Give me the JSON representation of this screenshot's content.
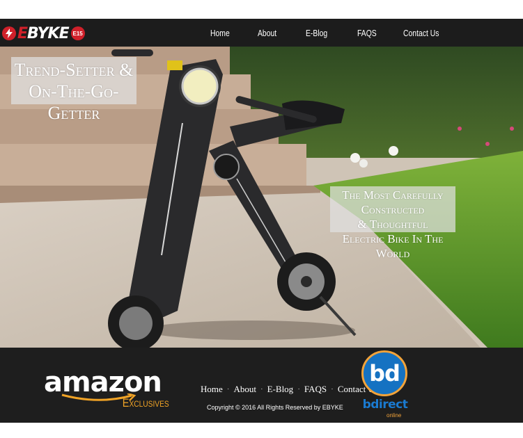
{
  "brand": {
    "logo_text_e": "E",
    "logo_text_rest": "BYKE",
    "logo_badge": "E15"
  },
  "nav": {
    "items": [
      {
        "label": "Home"
      },
      {
        "label": "About"
      },
      {
        "label": "E-Blog"
      },
      {
        "label": "FAQS"
      },
      {
        "label": "Contact Us"
      }
    ]
  },
  "hero": {
    "tagline_line1": "Trend-Setter &",
    "tagline_line2": "On-The-Go-Getter",
    "callout_line1": "The Most Carefully Constructed",
    "callout_line2": "& Thoughtful",
    "callout_line3": "Electric Bike In The World"
  },
  "footer": {
    "amazon_word": "amazon",
    "amazon_sub": "Exclusives",
    "nav": [
      "Home",
      "About",
      "E-Blog",
      "FAQS",
      "Contact Us"
    ],
    "separator": "·",
    "copyright": "Copyright © 2016 All Rights Reserved by EBYKE",
    "partner_mark": "bd",
    "partner_name": "bdirect",
    "partner_tag": "online"
  },
  "colors": {
    "topbar": "#1c1c1c",
    "footer": "#1e1e1e",
    "brand_red": "#d0202a",
    "amazon_orange": "#f0a326",
    "bdirect_blue": "#1572c2"
  }
}
